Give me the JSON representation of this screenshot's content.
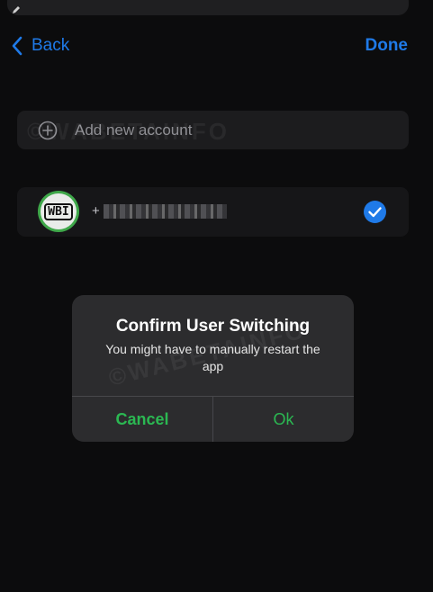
{
  "nav": {
    "back_label": "Back",
    "done_label": "Done"
  },
  "add_account": {
    "label": "Add new account",
    "icon": "plus-circle-icon"
  },
  "account": {
    "avatar_text": "WBI",
    "phone_prefix": "+",
    "selected": true
  },
  "dialog": {
    "title": "Confirm User Switching",
    "message": "You might have to manually restart the app",
    "cancel_label": "Cancel",
    "ok_label": "Ok"
  },
  "colors": {
    "accent_blue": "#1f7ae8",
    "accent_green": "#2bb852",
    "background": "#0c0c0d",
    "dialog_bg": "#2c2c2e"
  },
  "watermark": "©WABETAINFO"
}
